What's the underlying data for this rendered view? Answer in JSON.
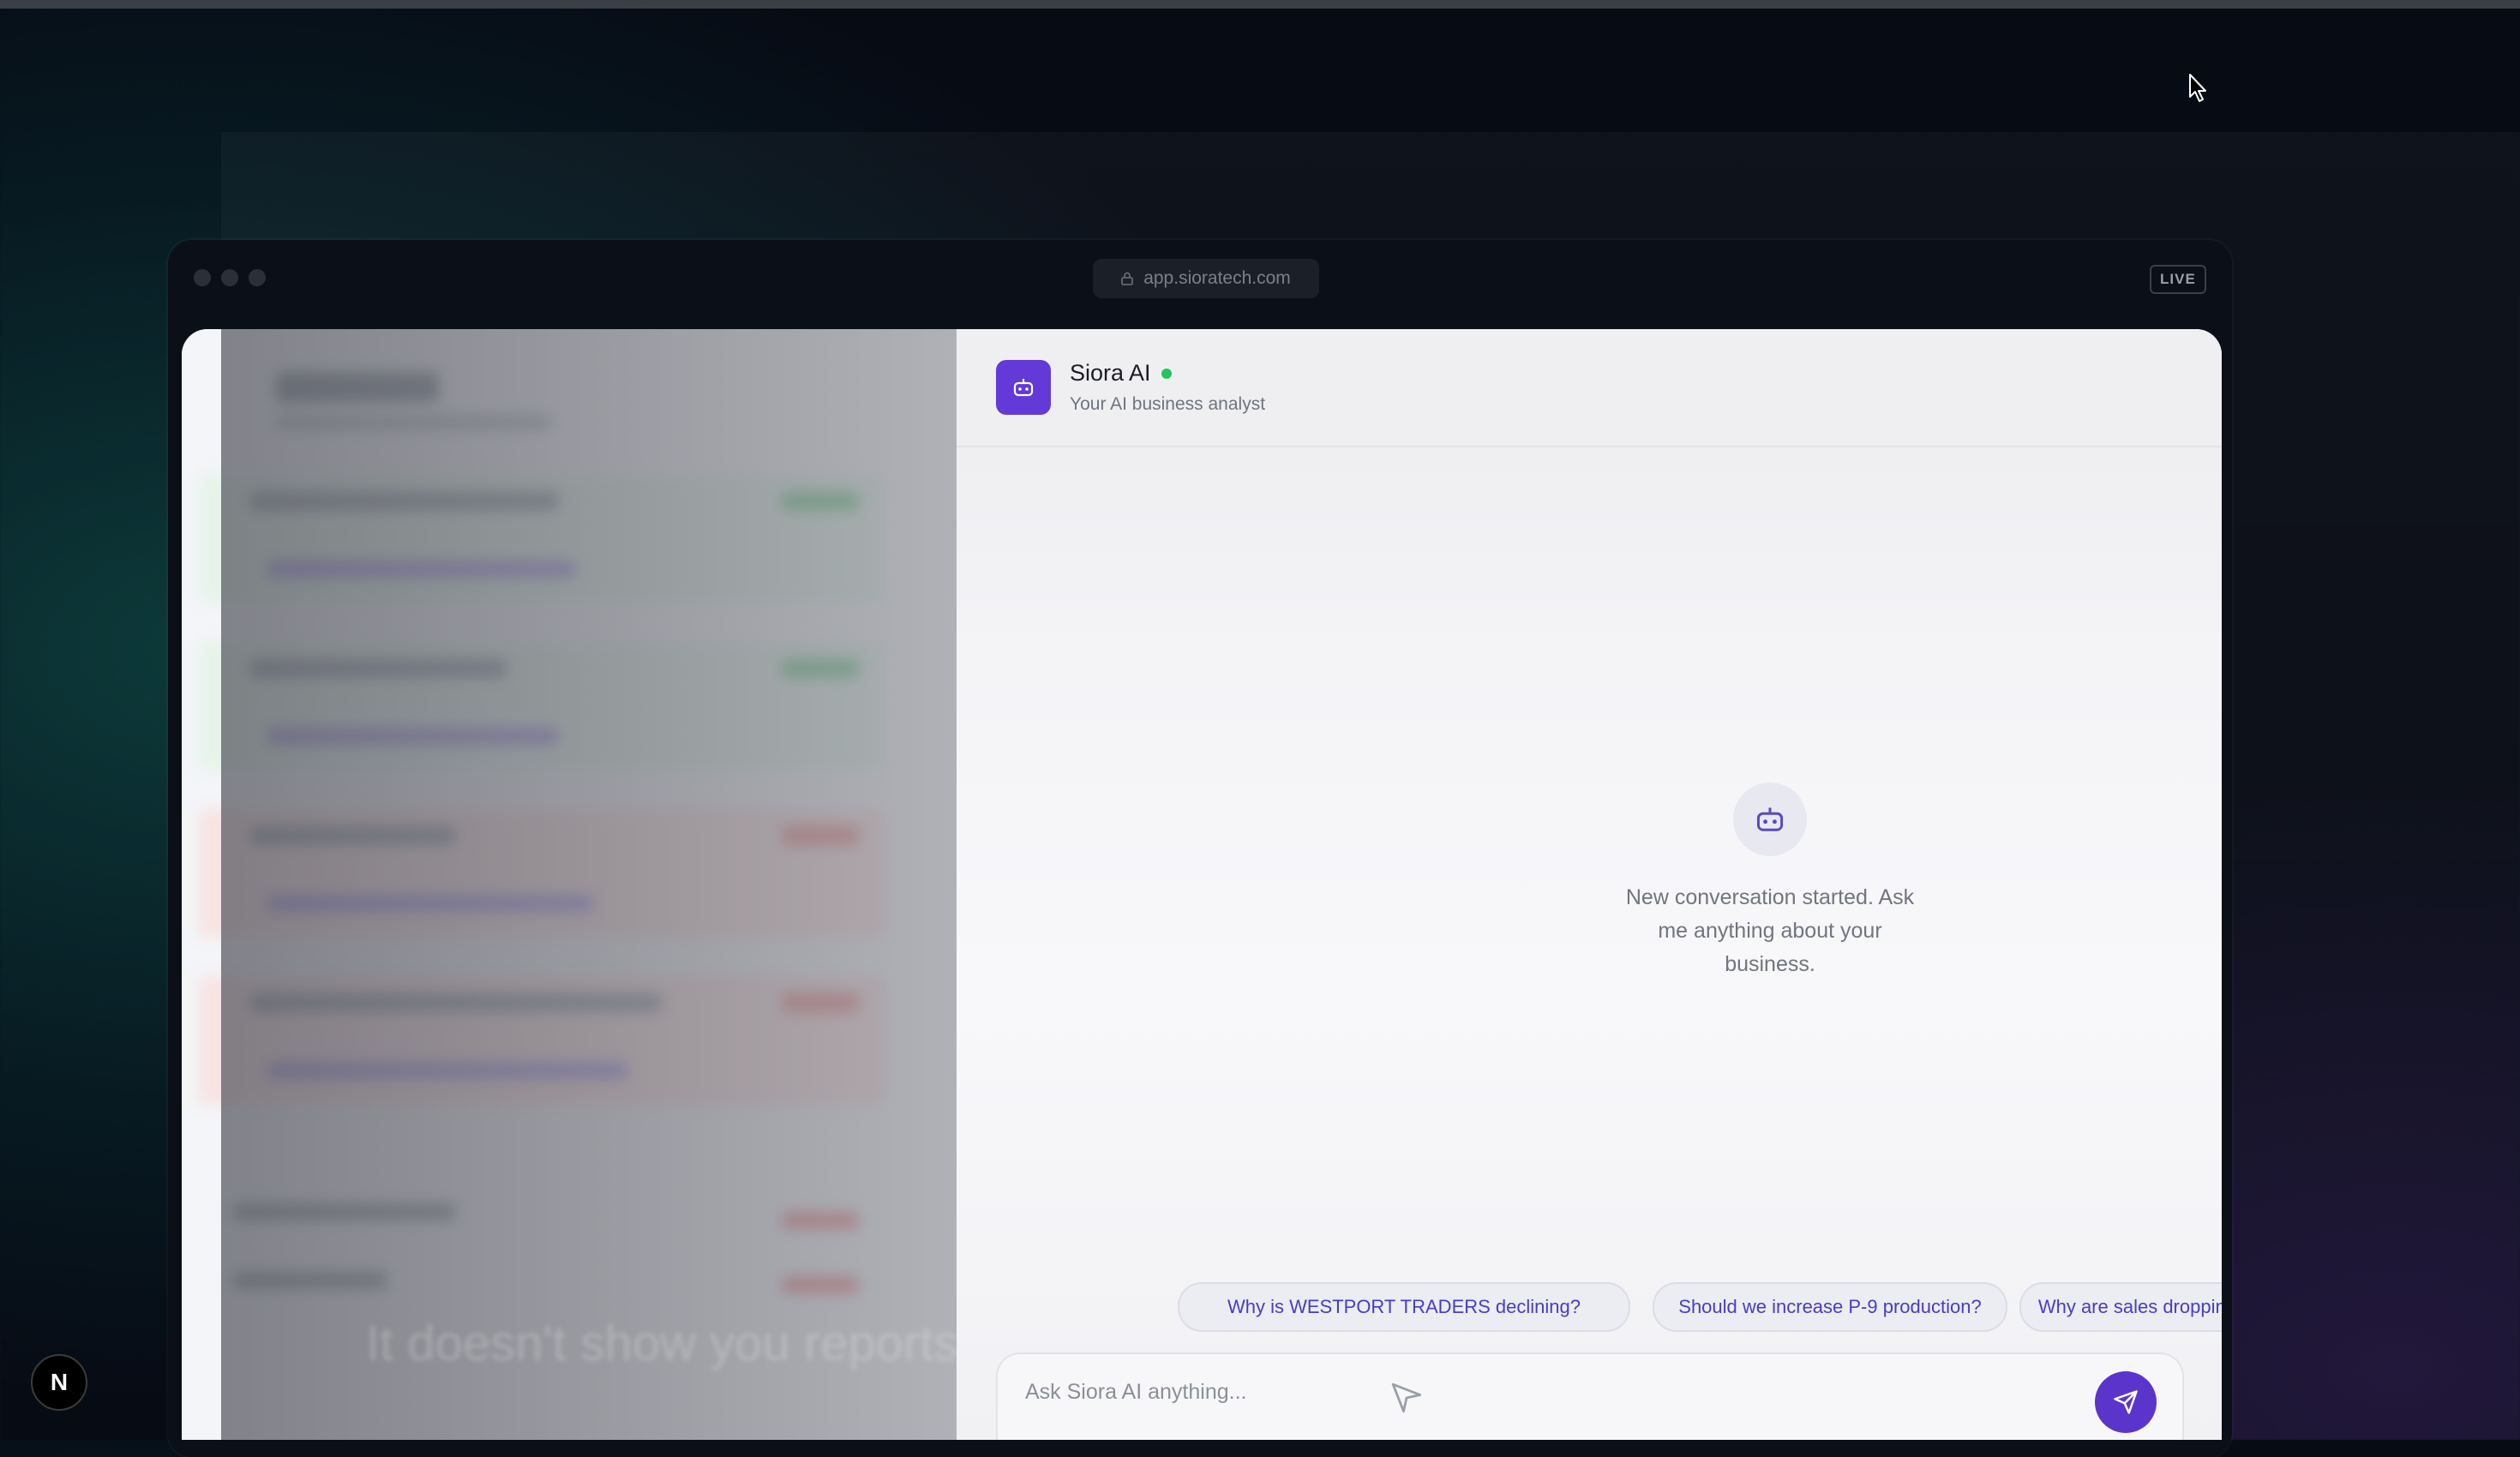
{
  "browser": {
    "url": "app.sioratech.com",
    "status_badge": "LIVE"
  },
  "chat": {
    "title": "Siora AI",
    "subtitle": "Your AI business analyst",
    "empty_state": "New conversation started. Ask me anything about your business.",
    "suggestions": [
      "Why is WESTPORT TRADERS declining?",
      "Should we increase P-9 production?",
      "Why are sales dropping in Westport?"
    ],
    "input_placeholder": "Ask Siora AI anything...",
    "accent_color": "#6339d8",
    "online_status_color": "#22c55e"
  },
  "background": {
    "tagline_line1": "It doesn't show you reports."
  },
  "framework_badge": "N"
}
